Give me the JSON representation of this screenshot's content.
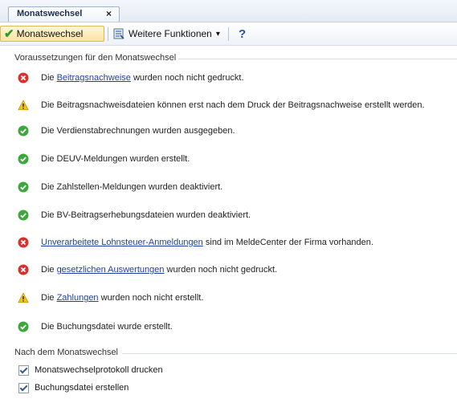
{
  "tab": {
    "label": "Monatswechsel",
    "close": "×"
  },
  "toolbar": {
    "main_button": "Monatswechsel",
    "more_button": "Weitere Funktionen",
    "more_arrow": "▾",
    "help": "?"
  },
  "section1": {
    "title": "Voraussetzungen für den Monatswechsel",
    "items": [
      {
        "status": "error",
        "pre": "Die ",
        "link": "Beitragsnachweise",
        "post": " wurden noch nicht gedruckt."
      },
      {
        "status": "warning",
        "pre": "Die Beitragsnachweisdateien können erst nach dem Druck der Beitragsnachweise erstellt werden.",
        "link": "",
        "post": ""
      },
      {
        "status": "ok",
        "pre": "Die Verdienstabrechnungen wurden ausgegeben.",
        "link": "",
        "post": ""
      },
      {
        "status": "ok",
        "pre": "Die DEUV-Meldungen wurden erstellt.",
        "link": "",
        "post": ""
      },
      {
        "status": "ok",
        "pre": "Die Zahlstellen-Meldungen wurden deaktiviert.",
        "link": "",
        "post": ""
      },
      {
        "status": "ok",
        "pre": "Die BV-Beitragserhebungsdateien wurden deaktiviert.",
        "link": "",
        "post": ""
      },
      {
        "status": "error",
        "pre": "",
        "link": "Unverarbeitete Lohnsteuer-Anmeldungen",
        "post": " sind im MeldeCenter der Firma vorhanden."
      },
      {
        "status": "error",
        "pre": "Die ",
        "link": "gesetzlichen Auswertungen",
        "post": " wurden noch nicht gedruckt."
      },
      {
        "status": "warning",
        "pre": "Die ",
        "link": "Zahlungen",
        "post": " wurden noch nicht erstellt."
      },
      {
        "status": "ok",
        "pre": "Die Buchungsdatei wurde erstellt.",
        "link": "",
        "post": ""
      }
    ]
  },
  "section2": {
    "title": "Nach dem Monatswechsel",
    "options": [
      {
        "label": "Monatswechselprotokoll drucken",
        "checked": true
      },
      {
        "label": "Buchungsdatei erstellen",
        "checked": true
      }
    ]
  },
  "colors": {
    "ok": "#3aa83a",
    "error": "#d9302e",
    "warning": "#f2c21b",
    "link": "#1f3fa8"
  }
}
